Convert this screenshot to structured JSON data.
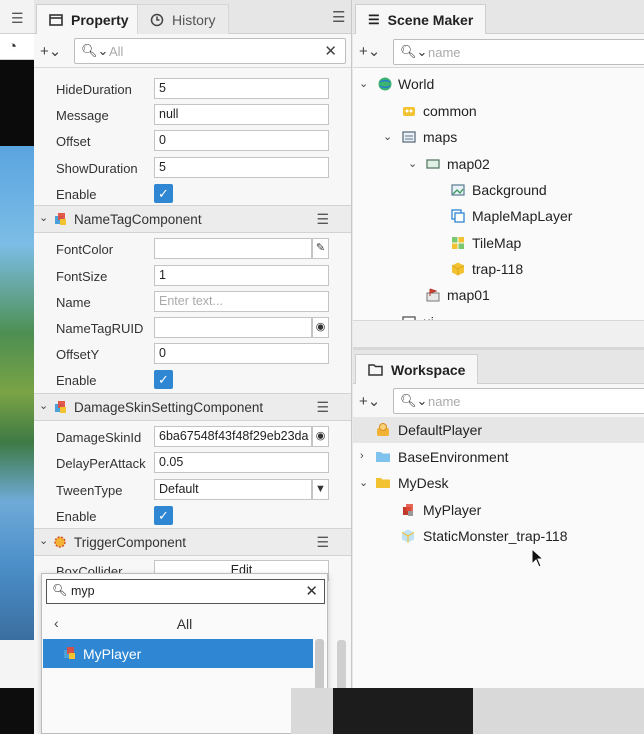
{
  "property_panel": {
    "tabs": [
      {
        "label": "Property",
        "icon": "property-panel-icon",
        "active": true
      },
      {
        "label": "History",
        "icon": "clock-icon",
        "active": false
      }
    ],
    "search_placeholder": "All",
    "rows_top": [
      {
        "label": "HideDuration",
        "value": "5"
      },
      {
        "label": "Message",
        "value": "null"
      },
      {
        "label": "Offset",
        "value": "0"
      },
      {
        "label": "ShowDuration",
        "value": "5"
      },
      {
        "label": "Enable",
        "checked": true
      }
    ],
    "nametag": {
      "title": "NameTagComponent",
      "rows": [
        {
          "label": "FontColor",
          "value": ""
        },
        {
          "label": "FontSize",
          "value": "1"
        },
        {
          "label": "Name",
          "placeholder": "Enter text..."
        },
        {
          "label": "NameTagRUID",
          "value": ""
        },
        {
          "label": "OffsetY",
          "value": "0"
        },
        {
          "label": "Enable",
          "checked": true
        }
      ]
    },
    "damageskin": {
      "title": "DamageSkinSettingComponent",
      "rows": [
        {
          "label": "DamageSkinId",
          "value": "6ba67548f43f48f29eb23da"
        },
        {
          "label": "DelayPerAttack",
          "value": "0.05"
        },
        {
          "label": "TweenType",
          "value": "Default"
        },
        {
          "label": "Enable",
          "checked": true
        }
      ]
    },
    "trigger": {
      "title": "TriggerComponent",
      "row_label": "BoxCollider",
      "row_button": "Edit"
    },
    "popup": {
      "query": "myp",
      "nav_label": "All",
      "items": [
        {
          "label": "MyPlayer",
          "selected": true
        }
      ]
    }
  },
  "scene_maker": {
    "tab_label": "Scene Maker",
    "search_placeholder": "name",
    "tree": [
      {
        "label": "World",
        "expanded": true,
        "icon": "globe-icon"
      },
      {
        "label": "common",
        "icon": "common-folder-icon"
      },
      {
        "label": "maps",
        "expanded": true,
        "icon": "maps-icon"
      },
      {
        "label": "map02",
        "expanded": true,
        "icon": "map-icon"
      },
      {
        "label": "Background",
        "icon": "background-image-icon"
      },
      {
        "label": "MapleMapLayer",
        "icon": "layer-icon"
      },
      {
        "label": "TileMap",
        "icon": "tilemap-icon"
      },
      {
        "label": "trap-118",
        "icon": "cube-icon"
      },
      {
        "label": "map01",
        "icon": "map-flag-icon"
      },
      {
        "label": "ui",
        "icon": "ui-icon"
      }
    ]
  },
  "workspace": {
    "tab_label": "Workspace",
    "search_placeholder": "name",
    "tree": [
      {
        "label": "DefaultPlayer",
        "icon": "player-icon",
        "selected": true
      },
      {
        "label": "BaseEnvironment",
        "icon": "folder-blue-icon",
        "expanded": false
      },
      {
        "label": "MyDesk",
        "icon": "folder-yellow-icon",
        "expanded": true
      },
      {
        "label": "MyPlayer",
        "icon": "player-model-icon"
      },
      {
        "label": "StaticMonster_trap-118",
        "icon": "monster-cube-icon"
      }
    ]
  },
  "colors": {
    "accent": "#2f86d3",
    "selected_row": "#e6e6e6",
    "panel_bg": "#f7f7f7"
  }
}
